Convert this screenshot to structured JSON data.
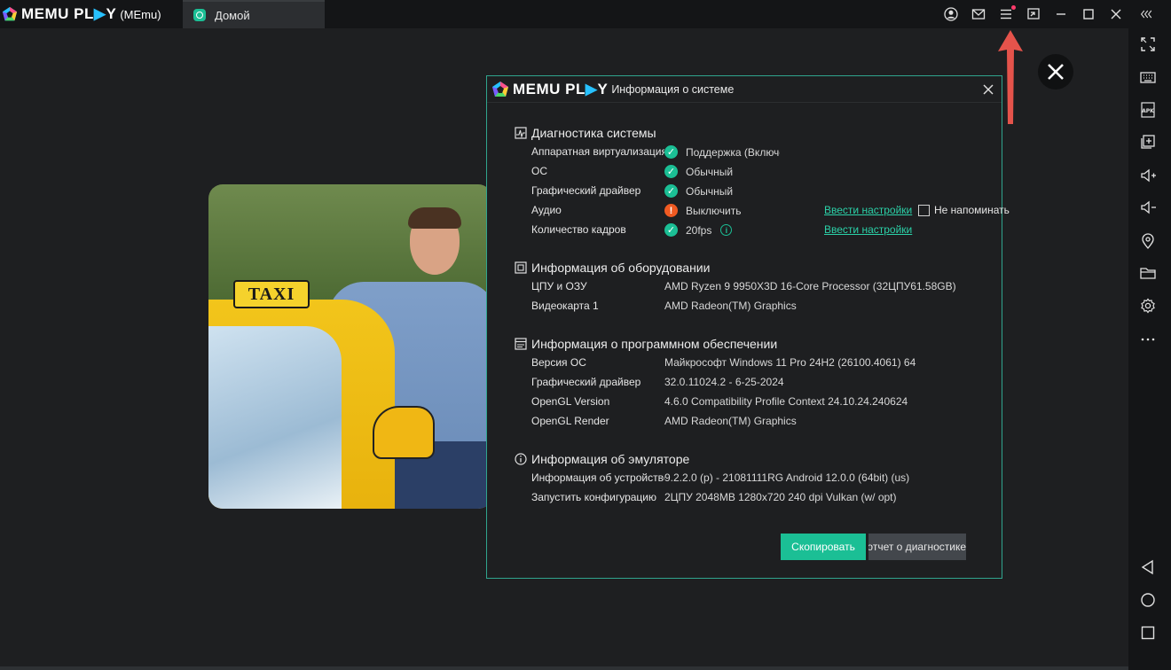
{
  "app": {
    "logo_text": "MEMU PL",
    "logo_play": "▶",
    "logo_end": "Y",
    "subtitle": "(MEmu)"
  },
  "tab": {
    "label": "Домой"
  },
  "colors": {
    "accent": "#1bbf95",
    "warning": "#f05a22",
    "link": "#2bd1a8",
    "arrow": "#e5534b"
  },
  "dialog": {
    "title": "Информация о системе",
    "sections": {
      "diagnostics": {
        "title": "Диагностика системы",
        "rows": [
          {
            "key": "Аппаратная виртуализация",
            "value": "Поддержка (Включено)",
            "status": "ok"
          },
          {
            "key": "ОС",
            "value": "Обычный",
            "status": "ok"
          },
          {
            "key": "Графический драйвер",
            "value": "Обычный",
            "status": "ok"
          },
          {
            "key": "Аудио",
            "value": "Выключить",
            "status": "warn",
            "link": "Ввести настройки",
            "checkbox_label": "Не напоминать"
          },
          {
            "key": "Количество кадров",
            "value": "20fps",
            "status": "ok",
            "link": "Ввести настройки"
          }
        ]
      },
      "hardware": {
        "title": "Информация об оборудовании",
        "rows": [
          {
            "key": "ЦПУ и ОЗУ",
            "value": "AMD Ryzen 9 9950X3D 16-Core Processor (32ЦПУ61.58GB)"
          },
          {
            "key": "Видеокарта 1",
            "value": "AMD Radeon(TM) Graphics"
          }
        ]
      },
      "software": {
        "title": "Информация о программном обеспечении",
        "rows": [
          {
            "key": "Версия ОС",
            "value": "Майкрософт Windows 11 Pro 24H2 (26100.4061) 64"
          },
          {
            "key": "Графический драйвер",
            "value": "32.0.11024.2 - 6-25-2024"
          },
          {
            "key": "OpenGL Version",
            "value": "4.6.0 Compatibility Profile Context 24.10.24.240624"
          },
          {
            "key": "OpenGL Render",
            "value": "AMD Radeon(TM) Graphics"
          }
        ]
      },
      "emulator": {
        "title": "Информация об эмуляторе",
        "rows": [
          {
            "key": "Информация об устройстве",
            "value": "9.2.2.0 (p) - 21081111RG Android 12.0.0 (64bit) (us)"
          },
          {
            "key": "Запустить конфигурацию",
            "value": "2ЦПУ 2048MB 1280x720 240 dpi Vulkan (w/ opt)"
          }
        ]
      }
    },
    "buttons": {
      "copy": "Скопировать",
      "report": "Отправить отчет о диагностике"
    }
  },
  "photo": {
    "sign_text": "TAXI"
  }
}
